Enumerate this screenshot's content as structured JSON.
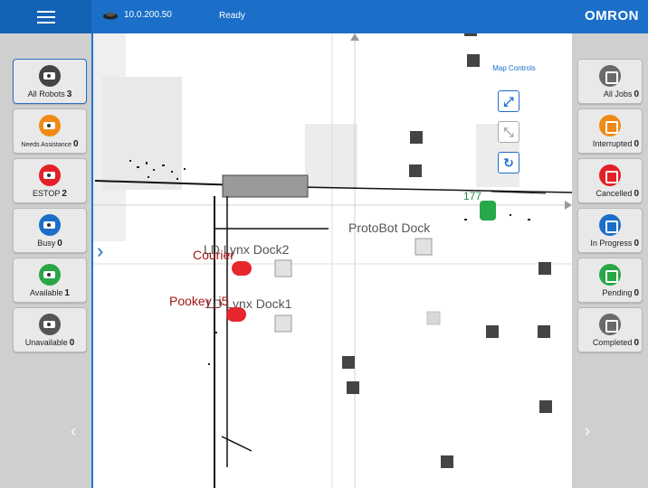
{
  "topbar": {
    "ip": "10.0.200.50",
    "status": "Ready",
    "brand": "OMRON"
  },
  "robots": [
    {
      "label": "All Robots",
      "count": "3",
      "color": "#444444"
    },
    {
      "label": "Needs Assistance",
      "count": "0",
      "color": "#ef8a17"
    },
    {
      "label": "ESTOP",
      "count": "2",
      "color": "#e3202a"
    },
    {
      "label": "Busy",
      "count": "0",
      "color": "#1b6fc8"
    },
    {
      "label": "Available",
      "count": "1",
      "color": "#29a645"
    },
    {
      "label": "Unavailable",
      "count": "0",
      "color": "#555555"
    }
  ],
  "jobs": [
    {
      "label": "All Jobs",
      "count": "0",
      "color": "#6a6a6a"
    },
    {
      "label": "Interrupted",
      "count": "0",
      "color": "#ef8a17"
    },
    {
      "label": "Cancelled",
      "count": "0",
      "color": "#e3202a"
    },
    {
      "label": "In Progress",
      "count": "0",
      "color": "#1b6fc8"
    },
    {
      "label": "Pending",
      "count": "0",
      "color": "#29a645"
    },
    {
      "label": "Completed",
      "count": "0",
      "color": "#6a6a6a"
    }
  ],
  "map": {
    "labels": {
      "protobot_dock": "ProtoBot Dock",
      "dock2": "LD Lynx Dock2",
      "dock1": "LD Lynx Dock1"
    },
    "robots": {
      "courier": "Courier",
      "pookey": "Pookey_i5",
      "green_id": "177"
    },
    "controls_title": "Map Controls",
    "controls": [
      "expand-icon",
      "collapse-icon",
      "refresh-icon"
    ]
  }
}
